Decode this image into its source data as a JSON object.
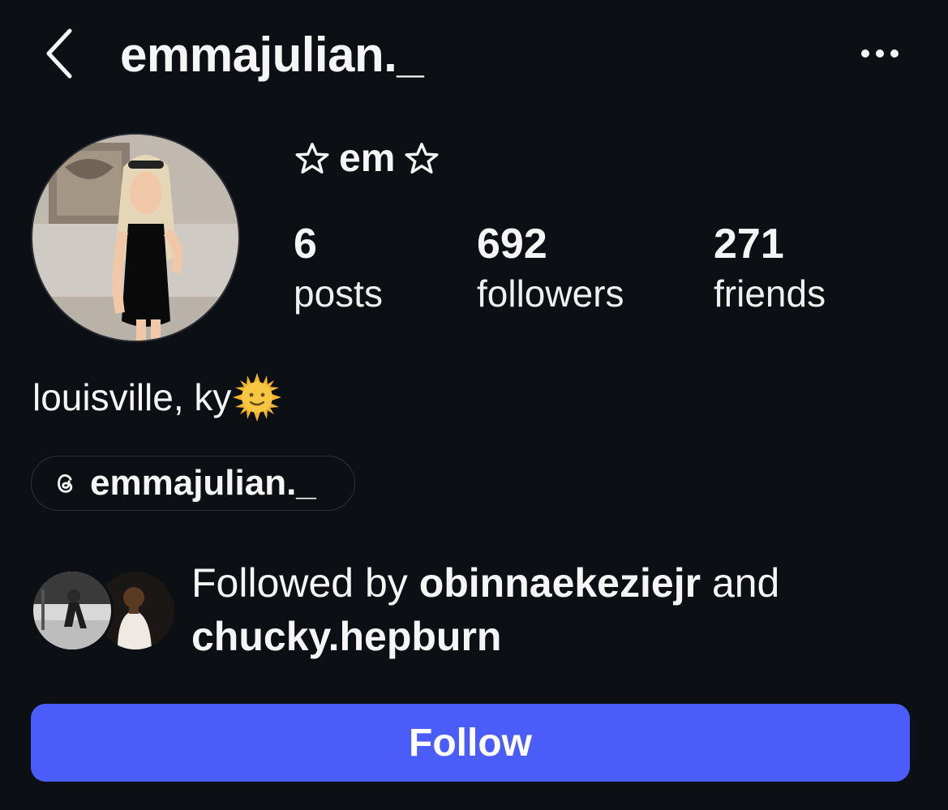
{
  "header": {
    "username": "emmajulian._",
    "back_icon": "chevron-left-icon",
    "more_icon": "more-horizontal-icon"
  },
  "profile": {
    "display_name": "em",
    "display_name_icon": "star-outline-icon",
    "stats": [
      {
        "value": "6",
        "label": "posts"
      },
      {
        "value": "692",
        "label": "followers"
      },
      {
        "value": "271",
        "label": "friends"
      }
    ],
    "bio": "louisville, ky",
    "bio_emoji": "sun-with-face-icon",
    "threads_handle": "emmajulian._",
    "threads_icon": "threads-icon"
  },
  "mutuals": {
    "prefix": "Followed by ",
    "user1": "obinnaekeziejr",
    "connector": " and ",
    "user2": "chucky.hepburn"
  },
  "actions": {
    "follow_label": "Follow"
  },
  "colors": {
    "background": "#0c1014",
    "text": "#f5f5f5",
    "follow_button": "#4a5df9",
    "pill_border": "#2f3338"
  }
}
